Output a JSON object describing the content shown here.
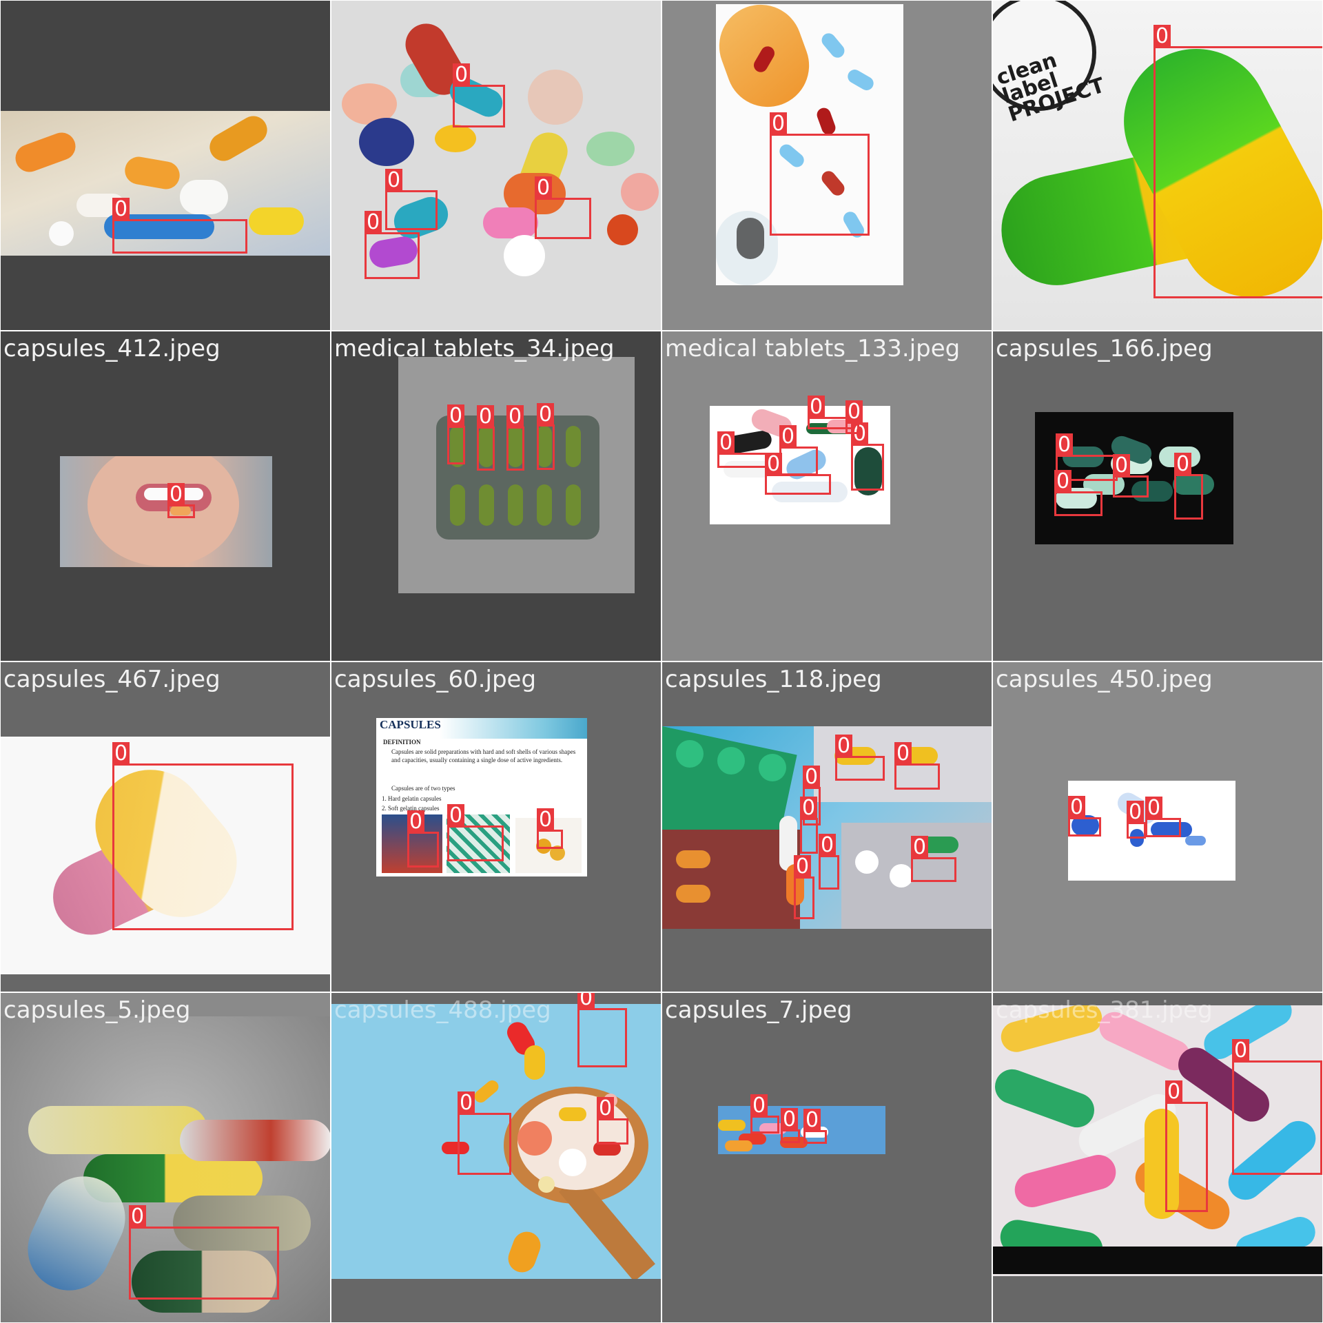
{
  "colors": {
    "box": "#e8383d",
    "label_text": "#f2f2f2",
    "bg_dark": "#444444",
    "bg_mid": "#676767",
    "bg_light": "#8a8a8a"
  },
  "class_id": "0",
  "tiles": [
    {
      "filename": "",
      "boxes": 1
    },
    {
      "filename": "",
      "boxes": 4
    },
    {
      "filename": "",
      "boxes": 1
    },
    {
      "filename": "",
      "boxes": 1
    },
    {
      "filename": "capsules_412.jpeg",
      "boxes": 1
    },
    {
      "filename": "medical tablets_34.jpeg",
      "boxes": 4
    },
    {
      "filename": "medical tablets_133.jpeg",
      "boxes": 6
    },
    {
      "filename": "capsules_166.jpeg",
      "boxes": 4
    },
    {
      "filename": "capsules_467.jpeg",
      "boxes": 1
    },
    {
      "filename": "capsules_60.jpeg",
      "boxes": 3
    },
    {
      "filename": "capsules_118.jpeg",
      "boxes": 7
    },
    {
      "filename": "capsules_450.jpeg",
      "boxes": 3
    },
    {
      "filename": "capsules_5.jpeg",
      "boxes": 1
    },
    {
      "filename": "capsules_488.jpeg",
      "boxes": 3
    },
    {
      "filename": "capsules_7.jpeg",
      "boxes": 3
    },
    {
      "filename": "capsules_381.jpeg",
      "boxes": 2
    }
  ],
  "logo": {
    "text": "clean\nlabel\nPROJECT"
  },
  "slide": {
    "title": "CAPSULES",
    "heading": "DEFINITION",
    "bullet": "Capsules are solid preparations with hard and soft shells of various shapes and capacities, usually containing a single dose of active ingredients.",
    "types_intro": "Capsules are of two types",
    "type_1": "1.  Hard gelatin capsules",
    "type_2": "2.  Soft gelatin capsules"
  }
}
